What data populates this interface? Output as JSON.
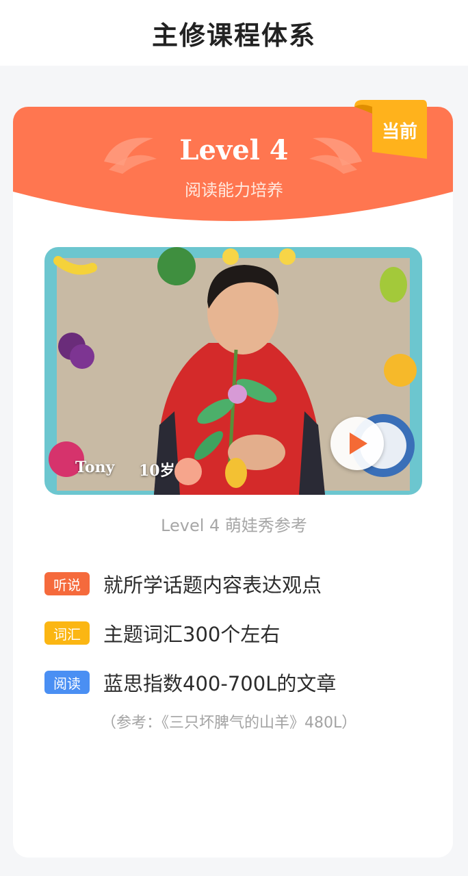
{
  "page": {
    "title": "主修课程体系"
  },
  "level": {
    "title": "Level 4",
    "subtitle": "阅读能力培养",
    "badge": "当前"
  },
  "video": {
    "child_name": "Tony",
    "child_age": "10岁",
    "caption": "Level 4 萌娃秀参考"
  },
  "skills": [
    {
      "tag": "听说",
      "color": "#f56a3c",
      "text": "就所学话题内容表达观点"
    },
    {
      "tag": "词汇",
      "color": "#fbb613",
      "text": "主题词汇300个左右"
    },
    {
      "tag": "阅读",
      "color": "#4a8ff3",
      "text": "蓝思指数400-700L的文章"
    }
  ],
  "reading_reference": "（参考：《三只坏脾气的山羊》480L）",
  "colors": {
    "header": "#ff7650",
    "badge": "#ffb21c",
    "play_icon": "#f46a35"
  }
}
